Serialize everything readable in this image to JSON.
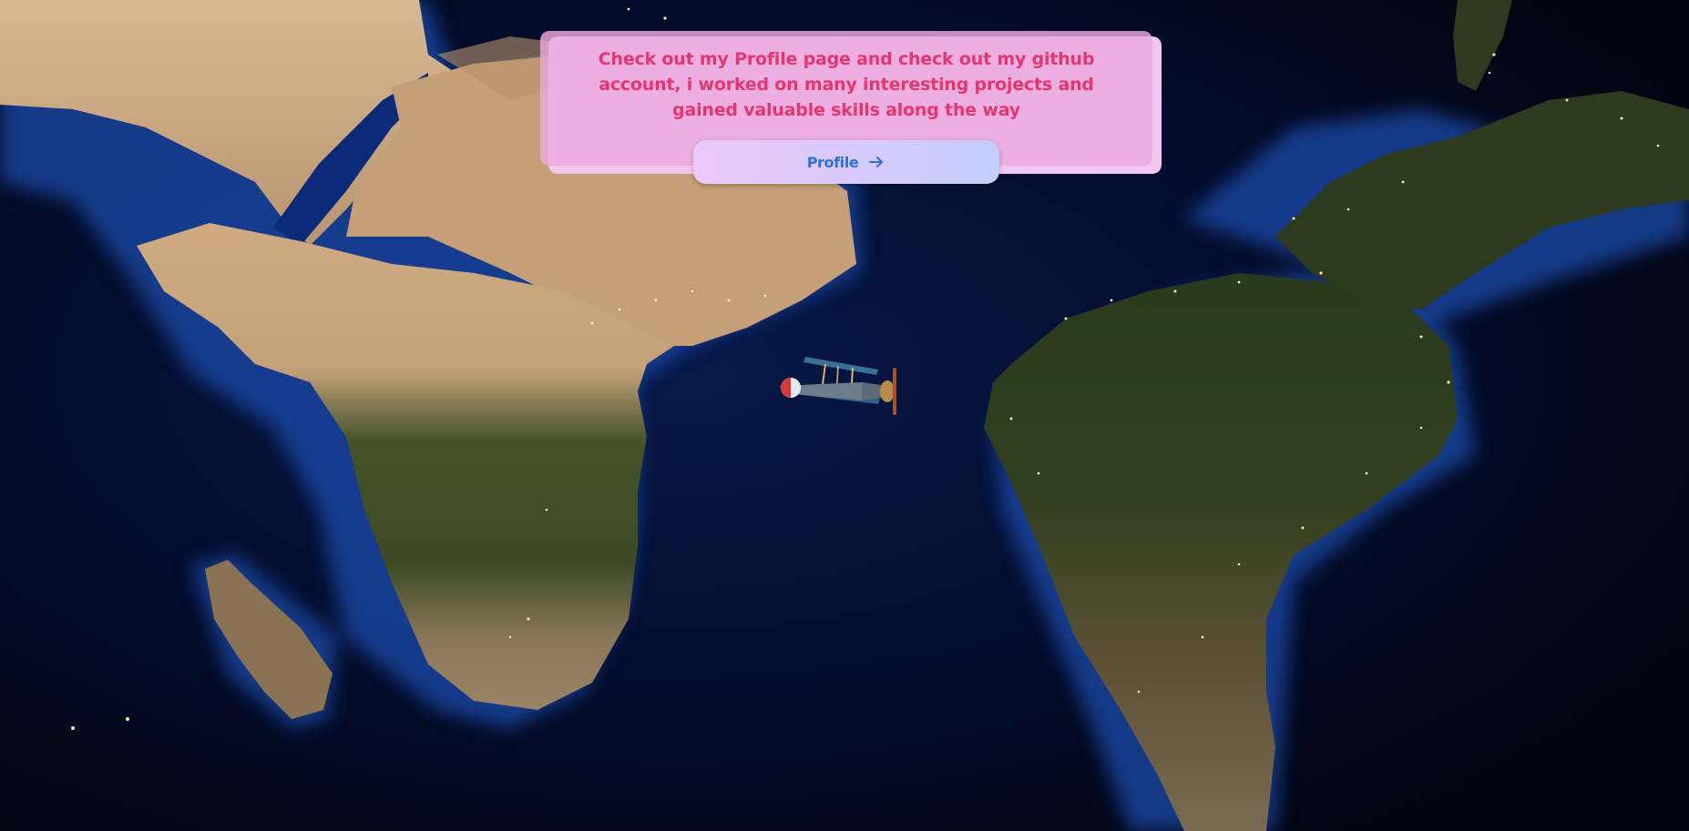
{
  "card": {
    "message": "Check out my Profile page and check out my github account, i worked on many interesting projects and gained valuable skills along the way"
  },
  "profile_button": {
    "label": "Profile",
    "icon": "arrow-right-icon"
  },
  "background": {
    "description_icon": "world-map-background",
    "ocean_color": "#0a1a55",
    "land_desert_color": "#c9a77e",
    "land_forest_color": "#3a4a22"
  },
  "plane": {
    "icon": "biplane-icon"
  },
  "colors": {
    "card_bg": "#ecaade",
    "card_text": "#e8356f",
    "button_text": "#2e6fe0"
  }
}
